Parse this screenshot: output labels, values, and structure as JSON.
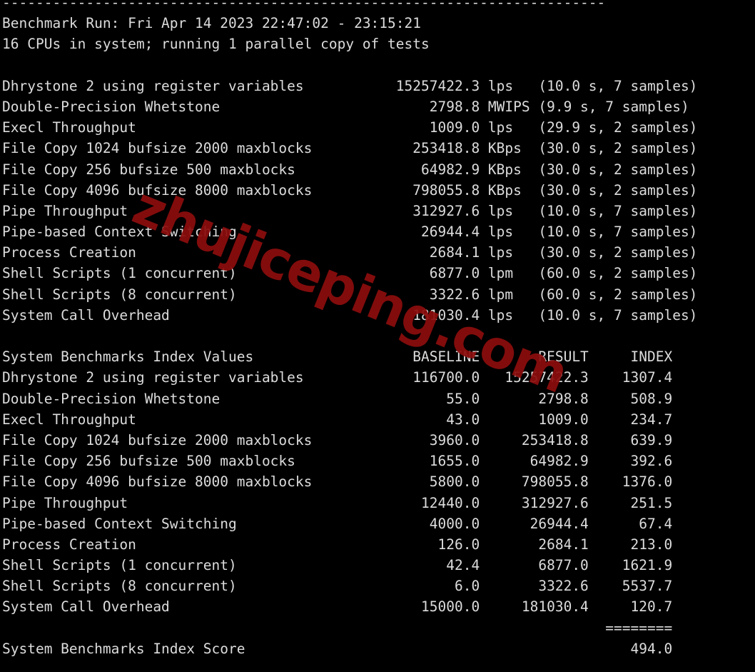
{
  "terminal": {
    "background_color": "#000000",
    "text_color": "#dcdcdc",
    "watermark": {
      "text": "zhujiceping.com",
      "color": "#8c0d0d"
    },
    "separator_line": "------------------------------------------------------------------------",
    "header": {
      "benchmark_run_label": "Benchmark Run:",
      "benchmark_run_value": "Fri Apr 14 2023 22:47:02 - 23:15:21",
      "benchmark_run_line": "Benchmark Run: Fri Apr 14 2023 22:47:02 - 23:15:21",
      "cpu_line": "16 CPUs in system; running 1 parallel copy of tests",
      "cpu_count": "16",
      "parallel_copies": "1"
    },
    "raw_results": {
      "rows": [
        {
          "name": "Dhrystone 2 using register variables",
          "value": "15257422.3",
          "unit": "lps",
          "duration": "10.0 s",
          "samples": "7 samples",
          "detail": "(10.0 s, 7 samples)"
        },
        {
          "name": "Double-Precision Whetstone",
          "value": "2798.8",
          "unit": "MWIPS",
          "duration": "9.9 s",
          "samples": "7 samples",
          "detail": "(9.9 s, 7 samples)"
        },
        {
          "name": "Execl Throughput",
          "value": "1009.0",
          "unit": "lps",
          "duration": "29.9 s",
          "samples": "2 samples",
          "detail": "(29.9 s, 2 samples)"
        },
        {
          "name": "File Copy 1024 bufsize 2000 maxblocks",
          "value": "253418.8",
          "unit": "KBps",
          "duration": "30.0 s",
          "samples": "2 samples",
          "detail": "(30.0 s, 2 samples)"
        },
        {
          "name": "File Copy 256 bufsize 500 maxblocks",
          "value": "64982.9",
          "unit": "KBps",
          "duration": "30.0 s",
          "samples": "2 samples",
          "detail": "(30.0 s, 2 samples)"
        },
        {
          "name": "File Copy 4096 bufsize 8000 maxblocks",
          "value": "798055.8",
          "unit": "KBps",
          "duration": "30.0 s",
          "samples": "2 samples",
          "detail": "(30.0 s, 2 samples)"
        },
        {
          "name": "Pipe Throughput",
          "value": "312927.6",
          "unit": "lps",
          "duration": "10.0 s",
          "samples": "7 samples",
          "detail": "(10.0 s, 7 samples)"
        },
        {
          "name": "Pipe-based Context Switching",
          "value": "26944.4",
          "unit": "lps",
          "duration": "10.0 s",
          "samples": "7 samples",
          "detail": "(10.0 s, 7 samples)"
        },
        {
          "name": "Process Creation",
          "value": "2684.1",
          "unit": "lps",
          "duration": "30.0 s",
          "samples": "2 samples",
          "detail": "(30.0 s, 2 samples)"
        },
        {
          "name": "Shell Scripts (1 concurrent)",
          "value": "6877.0",
          "unit": "lpm",
          "duration": "60.0 s",
          "samples": "2 samples",
          "detail": "(60.0 s, 2 samples)"
        },
        {
          "name": "Shell Scripts (8 concurrent)",
          "value": "3322.6",
          "unit": "lpm",
          "duration": "60.0 s",
          "samples": "2 samples",
          "detail": "(60.0 s, 2 samples)"
        },
        {
          "name": "System Call Overhead",
          "value": "181030.4",
          "unit": "lps",
          "duration": "10.0 s",
          "samples": "7 samples",
          "detail": "(10.0 s, 7 samples)"
        }
      ]
    },
    "index_table": {
      "title": "System Benchmarks Index Values",
      "columns": [
        "BASELINE",
        "RESULT",
        "INDEX"
      ],
      "rows": [
        {
          "name": "Dhrystone 2 using register variables",
          "baseline": "116700.0",
          "result": "15257422.3",
          "index": "1307.4"
        },
        {
          "name": "Double-Precision Whetstone",
          "baseline": "55.0",
          "result": "2798.8",
          "index": "508.9"
        },
        {
          "name": "Execl Throughput",
          "baseline": "43.0",
          "result": "1009.0",
          "index": "234.7"
        },
        {
          "name": "File Copy 1024 bufsize 2000 maxblocks",
          "baseline": "3960.0",
          "result": "253418.8",
          "index": "639.9"
        },
        {
          "name": "File Copy 256 bufsize 500 maxblocks",
          "baseline": "1655.0",
          "result": "64982.9",
          "index": "392.6"
        },
        {
          "name": "File Copy 4096 bufsize 8000 maxblocks",
          "baseline": "5800.0",
          "result": "798055.8",
          "index": "1376.0"
        },
        {
          "name": "Pipe Throughput",
          "baseline": "12440.0",
          "result": "312927.6",
          "index": "251.5"
        },
        {
          "name": "Pipe-based Context Switching",
          "baseline": "4000.0",
          "result": "26944.4",
          "index": "67.4"
        },
        {
          "name": "Process Creation",
          "baseline": "126.0",
          "result": "2684.1",
          "index": "213.0"
        },
        {
          "name": "Shell Scripts (1 concurrent)",
          "baseline": "42.4",
          "result": "6877.0",
          "index": "1621.9"
        },
        {
          "name": "Shell Scripts (8 concurrent)",
          "baseline": "6.0",
          "result": "3322.6",
          "index": "5537.7"
        },
        {
          "name": "System Call Overhead",
          "baseline": "15000.0",
          "result": "181030.4",
          "index": "120.7"
        }
      ],
      "equals_rule": "========",
      "score_label": "System Benchmarks Index Score",
      "score_value": "494.0"
    }
  }
}
